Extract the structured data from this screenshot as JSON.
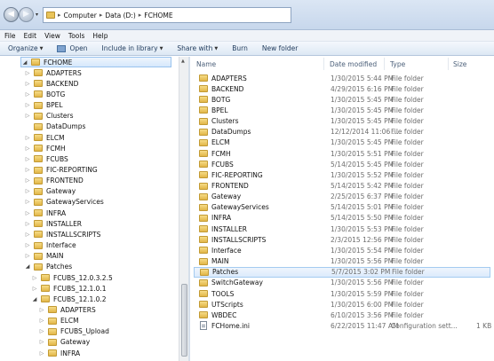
{
  "address": {
    "crumbs": [
      "Computer",
      "Data (D:)",
      "FCHOME"
    ]
  },
  "menu": [
    "File",
    "Edit",
    "View",
    "Tools",
    "Help"
  ],
  "toolbar": {
    "organize": "Organize",
    "open": "Open",
    "include": "Include in library",
    "share": "Share with",
    "burn": "Burn",
    "new_folder": "New folder"
  },
  "tree": [
    {
      "label": "FCHOME",
      "expanded": true,
      "selected": true
    },
    {
      "label": "ADAPTERS"
    },
    {
      "label": "BACKEND"
    },
    {
      "label": "BOTG"
    },
    {
      "label": "BPEL"
    },
    {
      "label": "Clusters"
    },
    {
      "label": "DataDumps",
      "leaf": true
    },
    {
      "label": "ELCM"
    },
    {
      "label": "FCMH"
    },
    {
      "label": "FCUBS"
    },
    {
      "label": "FIC-REPORTING"
    },
    {
      "label": "FRONTEND"
    },
    {
      "label": "Gateway"
    },
    {
      "label": "GatewayServices"
    },
    {
      "label": "INFRA"
    },
    {
      "label": "INSTALLER"
    },
    {
      "label": "INSTALLSCRIPTS"
    },
    {
      "label": "Interface"
    },
    {
      "label": "MAIN"
    },
    {
      "label": "Patches",
      "expanded": true
    },
    {
      "label": "FCUBS_12.0.3.2.5"
    },
    {
      "label": "FCUBS_12.1.0.1"
    },
    {
      "label": "FCUBS_12.1.0.2",
      "expanded": true
    },
    {
      "label": "ADAPTERS"
    },
    {
      "label": "ELCM"
    },
    {
      "label": "FCUBS_Upload"
    },
    {
      "label": "Gateway"
    },
    {
      "label": "INFRA"
    }
  ],
  "columns": {
    "name": "Name",
    "date": "Date modified",
    "type": "Type",
    "size": "Size"
  },
  "files": [
    {
      "name": "ADAPTERS",
      "date": "1/30/2015 5:44 PM",
      "type": "File folder",
      "size": ""
    },
    {
      "name": "BACKEND",
      "date": "4/29/2015 6:16 PM",
      "type": "File folder",
      "size": ""
    },
    {
      "name": "BOTG",
      "date": "1/30/2015 5:45 PM",
      "type": "File folder",
      "size": ""
    },
    {
      "name": "BPEL",
      "date": "1/30/2015 5:45 PM",
      "type": "File folder",
      "size": ""
    },
    {
      "name": "Clusters",
      "date": "1/30/2015 5:45 PM",
      "type": "File folder",
      "size": ""
    },
    {
      "name": "DataDumps",
      "date": "12/12/2014 11:06 ...",
      "type": "File folder",
      "size": ""
    },
    {
      "name": "ELCM",
      "date": "1/30/2015 5:45 PM",
      "type": "File folder",
      "size": ""
    },
    {
      "name": "FCMH",
      "date": "1/30/2015 5:51 PM",
      "type": "File folder",
      "size": ""
    },
    {
      "name": "FCUBS",
      "date": "5/14/2015 5:45 PM",
      "type": "File folder",
      "size": ""
    },
    {
      "name": "FIC-REPORTING",
      "date": "1/30/2015 5:52 PM",
      "type": "File folder",
      "size": ""
    },
    {
      "name": "FRONTEND",
      "date": "5/14/2015 5:42 PM",
      "type": "File folder",
      "size": ""
    },
    {
      "name": "Gateway",
      "date": "2/25/2015 6:37 PM",
      "type": "File folder",
      "size": ""
    },
    {
      "name": "GatewayServices",
      "date": "5/14/2015 5:01 PM",
      "type": "File folder",
      "size": ""
    },
    {
      "name": "INFRA",
      "date": "5/14/2015 5:50 PM",
      "type": "File folder",
      "size": ""
    },
    {
      "name": "INSTALLER",
      "date": "1/30/2015 5:53 PM",
      "type": "File folder",
      "size": ""
    },
    {
      "name": "INSTALLSCRIPTS",
      "date": "2/3/2015 12:56 PM",
      "type": "File folder",
      "size": ""
    },
    {
      "name": "Interface",
      "date": "1/30/2015 5:54 PM",
      "type": "File folder",
      "size": ""
    },
    {
      "name": "MAIN",
      "date": "1/30/2015 5:56 PM",
      "type": "File folder",
      "size": ""
    },
    {
      "name": "Patches",
      "date": "5/7/2015 3:02 PM",
      "type": "File folder",
      "size": "",
      "selected": true
    },
    {
      "name": "SwitchGateway",
      "date": "1/30/2015 5:56 PM",
      "type": "File folder",
      "size": ""
    },
    {
      "name": "TOOLS",
      "date": "1/30/2015 5:59 PM",
      "type": "File folder",
      "size": ""
    },
    {
      "name": "UTScripts",
      "date": "1/30/2015 6:00 PM",
      "type": "File folder",
      "size": ""
    },
    {
      "name": "WBDEC",
      "date": "6/10/2015 3:56 PM",
      "type": "File folder",
      "size": ""
    },
    {
      "name": "FCHome.ini",
      "date": "6/22/2015 11:47 AM",
      "type": "Configuration sett...",
      "size": "1 KB",
      "ini": true
    }
  ]
}
